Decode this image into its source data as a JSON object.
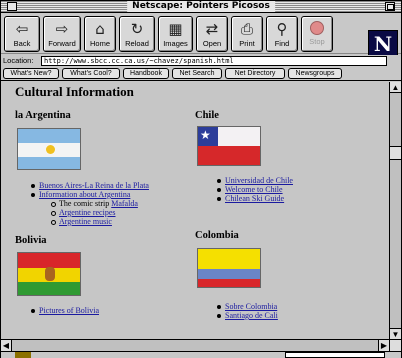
{
  "window": {
    "title": "Netscape: Pointers Picosos",
    "logo_letter": "N"
  },
  "toolbar": {
    "buttons": [
      {
        "label": "Back",
        "icon": "back-arrow-icon",
        "glyph": "⇦"
      },
      {
        "label": "Forward",
        "icon": "forward-arrow-icon",
        "glyph": "⇨"
      },
      {
        "label": "Home",
        "icon": "home-icon",
        "glyph": "⌂"
      },
      {
        "label": "Reload",
        "icon": "reload-icon",
        "glyph": "↻"
      },
      {
        "label": "Images",
        "icon": "images-icon",
        "glyph": "▦"
      },
      {
        "label": "Open",
        "icon": "open-icon",
        "glyph": "⇄"
      },
      {
        "label": "Print",
        "icon": "print-icon",
        "glyph": "⎙"
      },
      {
        "label": "Find",
        "icon": "find-icon",
        "glyph": "⚲"
      },
      {
        "label": "Stop",
        "icon": "stop-icon",
        "glyph": ""
      }
    ]
  },
  "location": {
    "label": "Location:",
    "url": "http://www.sbcc.cc.ca.us/~chavez/spanish.html"
  },
  "directory": {
    "buttons": [
      "What's New?",
      "What's Cool?",
      "Handbook",
      "Net Search",
      "Net Directory",
      "Newsgroups"
    ]
  },
  "page": {
    "title": "Cultural Information",
    "argentina": {
      "heading": "la Argentina",
      "links": [
        "Buenos Aires-La Reina de la Plata",
        "Information about Argentina"
      ],
      "sub_text": "The comic strip",
      "sub_links": [
        "Mafalda",
        "Argentine recipes",
        "Argentine music"
      ]
    },
    "chile": {
      "heading": "Chile",
      "links": [
        "Universidad de Chile",
        "Welcome to Chile",
        "Chilean Ski Guide"
      ]
    },
    "bolivia": {
      "heading": "Bolivia",
      "links": [
        "Pictures of Bolivia"
      ]
    },
    "colombia": {
      "heading": "Colombia",
      "links": [
        "Sobre Colombia",
        "Santiago de Cali"
      ]
    }
  },
  "colors": {
    "link": "#1a1aa0",
    "content_bg": "#c6c6c6",
    "argentina_blue": "#86b8e2",
    "bolivia_red": "#d8262a",
    "bolivia_yellow": "#f1d400",
    "bolivia_green": "#2f9a32",
    "colombia_yellow": "#f5e000",
    "colombia_blue": "#6a85c8",
    "colombia_red": "#d8262a"
  }
}
